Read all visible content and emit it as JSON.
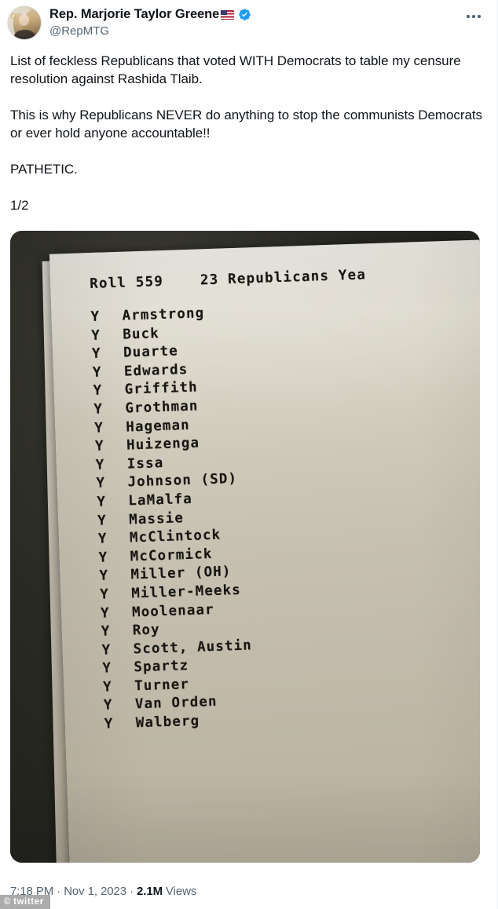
{
  "header": {
    "display_name": "Rep. Marjorie Taylor Greene",
    "flag_icon": "us-flag-emoji",
    "verified_badge": "verified-check-icon",
    "handle": "@RepMTG",
    "more_label": "More",
    "avatar_alt": "profile-photo"
  },
  "tweet": {
    "text": "List of feckless Republicans that voted WITH Democrats to table my censure resolution against Rashida Tlaib.\n\nThis is why Republicans NEVER do anything to stop the communists Democrats or ever hold anyone accountable!!\n\nPATHETIC.\n\n1/2"
  },
  "photo": {
    "document": {
      "title": "Roll 559    23 Republicans Yea",
      "roll_number": "559",
      "yea_count": "23",
      "votes": [
        {
          "mark": "Y",
          "name": "Armstrong"
        },
        {
          "mark": "Y",
          "name": "Buck"
        },
        {
          "mark": "Y",
          "name": "Duarte"
        },
        {
          "mark": "Y",
          "name": "Edwards"
        },
        {
          "mark": "Y",
          "name": "Griffith"
        },
        {
          "mark": "Y",
          "name": "Grothman"
        },
        {
          "mark": "Y",
          "name": "Hageman"
        },
        {
          "mark": "Y",
          "name": "Huizenga"
        },
        {
          "mark": "Y",
          "name": "Issa"
        },
        {
          "mark": "Y",
          "name": "Johnson (SD)"
        },
        {
          "mark": "Y",
          "name": "LaMalfa"
        },
        {
          "mark": "Y",
          "name": "Massie"
        },
        {
          "mark": "Y",
          "name": "McClintock"
        },
        {
          "mark": "Y",
          "name": "McCormick"
        },
        {
          "mark": "Y",
          "name": "Miller (OH)"
        },
        {
          "mark": "Y",
          "name": "Miller-Meeks"
        },
        {
          "mark": "Y",
          "name": "Moolenaar"
        },
        {
          "mark": "Y",
          "name": "Roy"
        },
        {
          "mark": "Y",
          "name": "Scott, Austin"
        },
        {
          "mark": "Y",
          "name": "Spartz"
        },
        {
          "mark": "Y",
          "name": "Turner"
        },
        {
          "mark": "Y",
          "name": "Van Orden"
        },
        {
          "mark": "Y",
          "name": "Walberg"
        }
      ]
    }
  },
  "footer": {
    "time": "7:18 PM",
    "sep1": " · ",
    "date": "Nov 1, 2023",
    "sep2": " · ",
    "views_count": "2.1M",
    "views_label": " Views",
    "watermark": "twitter",
    "watermark_symbol": "©"
  },
  "colors": {
    "text_primary": "#0f1419",
    "text_secondary": "#536471",
    "verified_blue": "#1d9bf0",
    "background": "#ffffff"
  }
}
